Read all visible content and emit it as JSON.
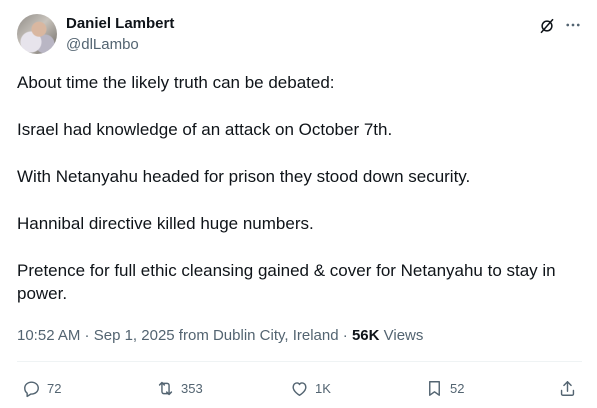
{
  "author": {
    "display_name": "Daniel Lambert",
    "handle": "@dlLambo"
  },
  "post": {
    "paragraphs": [
      "About time the likely truth can be debated:",
      "Israel had knowledge of an attack on October 7th.",
      "With Netanyahu headed for prison they stood down security.",
      "Hannibal directive killed huge numbers.",
      "Pretence for full ethic cleansing gained & cover for Netanyahu to stay in power."
    ]
  },
  "meta": {
    "time": "10:52 AM",
    "separator1": " · ",
    "date": "Sep 1, 2025",
    "location": " from Dublin City, Ireland",
    "separator2": " · ",
    "views_count": "56K",
    "views_label": " Views"
  },
  "actions": {
    "replies": "72",
    "reposts": "353",
    "likes": "1K",
    "bookmarks": "52"
  },
  "colors": {
    "text": "#0f1419",
    "secondary": "#536471",
    "divider": "#eff3f4"
  },
  "icons": [
    "grok-icon",
    "more-icon",
    "reply-icon",
    "repost-icon",
    "like-icon",
    "bookmark-icon",
    "share-icon"
  ]
}
